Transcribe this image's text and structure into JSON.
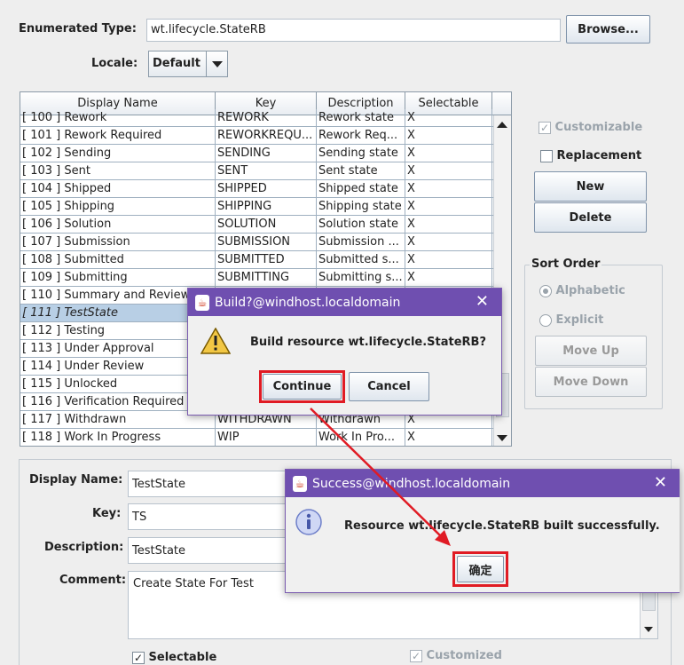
{
  "form": {
    "enum_type_label": "Enumerated Type:",
    "enum_type_value": "wt.lifecycle.StateRB",
    "browse_label": "Browse...",
    "locale_label": "Locale:",
    "locale_value": "Default"
  },
  "table": {
    "headers": [
      "Display Name",
      "Key",
      "Description",
      "Selectable"
    ],
    "rows": [
      {
        "name": "[ 100 ]  Rework",
        "key": "REWORK",
        "desc": "Rework state",
        "sel": "X"
      },
      {
        "name": "[ 101 ]  Rework Required",
        "key": "REWORKREQU...",
        "desc": "Rework Req...",
        "sel": "X"
      },
      {
        "name": "[ 102 ]  Sending",
        "key": "SENDING",
        "desc": "Sending state",
        "sel": "X"
      },
      {
        "name": "[ 103 ]  Sent",
        "key": "SENT",
        "desc": "Sent state",
        "sel": "X"
      },
      {
        "name": "[ 104 ]  Shipped",
        "key": "SHIPPED",
        "desc": "Shipped state",
        "sel": "X"
      },
      {
        "name": "[ 105 ]  Shipping",
        "key": "SHIPPING",
        "desc": "Shipping state",
        "sel": "X"
      },
      {
        "name": "[ 106 ]  Solution",
        "key": "SOLUTION",
        "desc": "Solution state",
        "sel": "X"
      },
      {
        "name": "[ 107 ]  Submission",
        "key": "SUBMISSION",
        "desc": "Submission ...",
        "sel": "X"
      },
      {
        "name": "[ 108 ]  Submitted",
        "key": "SUBMITTED",
        "desc": "Submitted s...",
        "sel": "X"
      },
      {
        "name": "[ 109 ]  Submitting",
        "key": "SUBMITTING",
        "desc": "Submitting s...",
        "sel": "X"
      },
      {
        "name": "[ 110 ]  Summary and Review",
        "key": "",
        "desc": "",
        "sel": ""
      },
      {
        "name": "[ 111 ]  TestState",
        "key": "",
        "desc": "",
        "sel": ""
      },
      {
        "name": "[ 112 ]  Testing",
        "key": "",
        "desc": "",
        "sel": ""
      },
      {
        "name": "[ 113 ]  Under Approval",
        "key": "",
        "desc": "",
        "sel": ""
      },
      {
        "name": "[ 114 ]  Under Review",
        "key": "",
        "desc": "",
        "sel": ""
      },
      {
        "name": "[ 115 ]  Unlocked",
        "key": "",
        "desc": "",
        "sel": ""
      },
      {
        "name": "[ 116 ]  Verification Required",
        "key": "",
        "desc": "",
        "sel": ""
      },
      {
        "name": "[ 117 ]  Withdrawn",
        "key": "WITHDRAWN",
        "desc": "Withdrawn",
        "sel": "X"
      },
      {
        "name": "[ 118 ]  Work In Progress",
        "key": "WIP",
        "desc": "Work In Pro...",
        "sel": "X"
      }
    ],
    "selected_index": 11
  },
  "side": {
    "customizable": "Customizable",
    "replacement": "Replacement",
    "new_label": "New",
    "delete_label": "Delete",
    "sort_order": "Sort Order",
    "alphabetic": "Alphabetic",
    "explicit": "Explicit",
    "move_up": "Move Up",
    "move_down": "Move Down"
  },
  "detail": {
    "display_name_label": "Display Name:",
    "display_name_value": "TestState",
    "key_label": "Key:",
    "key_value": "TS",
    "description_label": "Description:",
    "description_value": "TestState",
    "comment_label": "Comment:",
    "comment_value": "Create State For Test",
    "selectable_label": "Selectable",
    "customized_label": "Customized"
  },
  "build_dialog": {
    "title": "Build?@windhost.localdomain",
    "message": "Build resource wt.lifecycle.StateRB?",
    "continue_label": "Continue",
    "cancel_label": "Cancel"
  },
  "success_dialog": {
    "title": "Success@windhost.localdomain",
    "message": "Resource wt.lifecycle.StateRB built successfully.",
    "ok_label": "确定"
  },
  "colors": {
    "title_bar": "#6f4fb0",
    "highlight": "#e01b24",
    "row_selected": "#b8cfe5"
  }
}
